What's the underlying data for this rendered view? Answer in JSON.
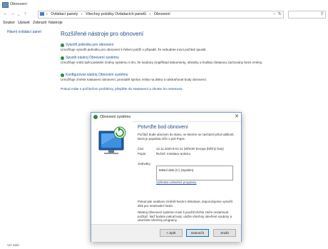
{
  "window": {
    "title": "Obnovení"
  },
  "address": {
    "crumbs": [
      "›",
      "Ovládací panely",
      "›",
      "Všechny položky Ovládacích panelů",
      "›",
      "Obnovení"
    ],
    "search_placeholder": ""
  },
  "menu": [
    "Soubor",
    "Upravit",
    "Zobrazit",
    "Nástroje"
  ],
  "sidebar": {
    "home_link": "Hlavní ovládací panel",
    "see_also": "Viz také"
  },
  "main": {
    "heading": "Rozšířené nástroje pro obnovení",
    "sections": [
      {
        "link": "Vytvořit jednotku pro obnovení",
        "desc": "Umožňuje vytvořit jednotku pro obnovení k řešení potíží v případě, že nebudete moct  počítač spustit."
      },
      {
        "link": "Spustit nástroj Obnovení systému",
        "desc": "Umožňuje vrátit zpět poslední změny systému s tím, že soubory (například dokumenty, obrázky a hudba) zůstanou zachovány beze změny."
      },
      {
        "link": "Konfigurovat nástroj Obnovení systému",
        "desc": "Umožňuje změnit nastavení obnovení, provádět správu místa na disku a odstraňovat body obnovení."
      }
    ],
    "help": "Pokud máte s počítačem problémy, přejděte do Nastavení a zkuste ho resetovat."
  },
  "dialog": {
    "title": "Obnovení systému",
    "heading": "Potvrďte bod obnovení",
    "intro": "Počítač bude obnoven do stavu, ve kterém se nacházel před událostí, která je popsána níže v poli Popis.",
    "time_label": "Čas:",
    "time_value": "12.11.2020 9:01:41 (Střední Evropa (běžný čas))",
    "desc_label": "Popis:",
    "desc_value": "Ručně: Instalace antiviru",
    "drives_label": "Jednotky:",
    "drive_row": "Místní disk (C:) (Systém)",
    "scan_link": "Vyhledat ovlivněné programy",
    "note1": "Pokud jste nedávno změnili heslo k Windows, doporučujeme vytvořit disk pro resetování hesla.",
    "note2": "Nástroj Obnovení systému musí k použití těchto změn restartovat počítač. Než budete pokračovat, uložte všechny otevřené soubory a ukončete všechny programy.",
    "back": "< Zpět",
    "finish": "Dokončit",
    "cancel": "Zrušit"
  }
}
